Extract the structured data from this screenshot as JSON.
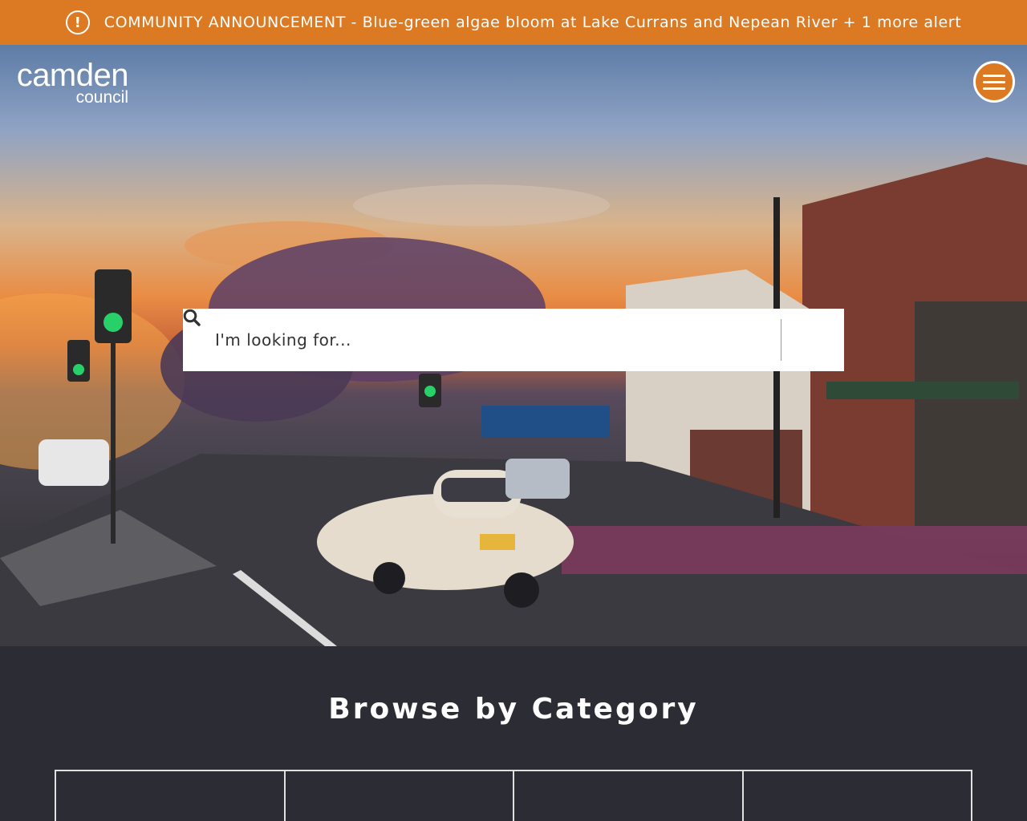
{
  "alert": {
    "icon": "exclamation-circle-icon",
    "text": "COMMUNITY ANNOUNCEMENT - Blue-green algae bloom at Lake Currans and Nepean River + 1 more alert"
  },
  "header": {
    "logo_main": "camden",
    "logo_sub": "council",
    "menu_icon": "hamburger-menu-icon"
  },
  "search": {
    "placeholder": "I'm looking for...",
    "value": "",
    "button_icon": "search-icon"
  },
  "browse": {
    "title": "Browse by Category",
    "categories": [
      "",
      "",
      "",
      ""
    ]
  },
  "colors": {
    "accent": "#dc7a24",
    "section_bg": "#2c2c35"
  }
}
